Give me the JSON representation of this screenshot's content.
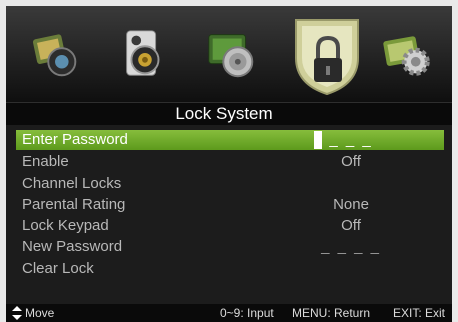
{
  "menu_icons": [
    {
      "name": "picture-menu-icon"
    },
    {
      "name": "sound-menu-icon"
    },
    {
      "name": "channel-menu-icon"
    },
    {
      "name": "lock-menu-icon",
      "active": true
    },
    {
      "name": "setup-menu-icon"
    }
  ],
  "title": "Lock System",
  "items": [
    {
      "label": "Enter Password",
      "value": "_ _ _"
    },
    {
      "label": "Enable",
      "value": "Off"
    },
    {
      "label": "Channel Locks",
      "value": ""
    },
    {
      "label": "Parental Rating",
      "value": "None"
    },
    {
      "label": "Lock Keypad",
      "value": "Off"
    },
    {
      "label": "New Password",
      "value": "_ _ _ _"
    },
    {
      "label": "Clear Lock",
      "value": ""
    }
  ],
  "footer": {
    "move": "Move",
    "input": "0~9: Input",
    "return": "MENU: Return",
    "exit": "EXIT: Exit"
  },
  "colors": {
    "highlight": "#6fa829",
    "osd_background": "#1c1c1c",
    "text_dim": "#b8b8b8",
    "text_bright": "#ffffff"
  }
}
